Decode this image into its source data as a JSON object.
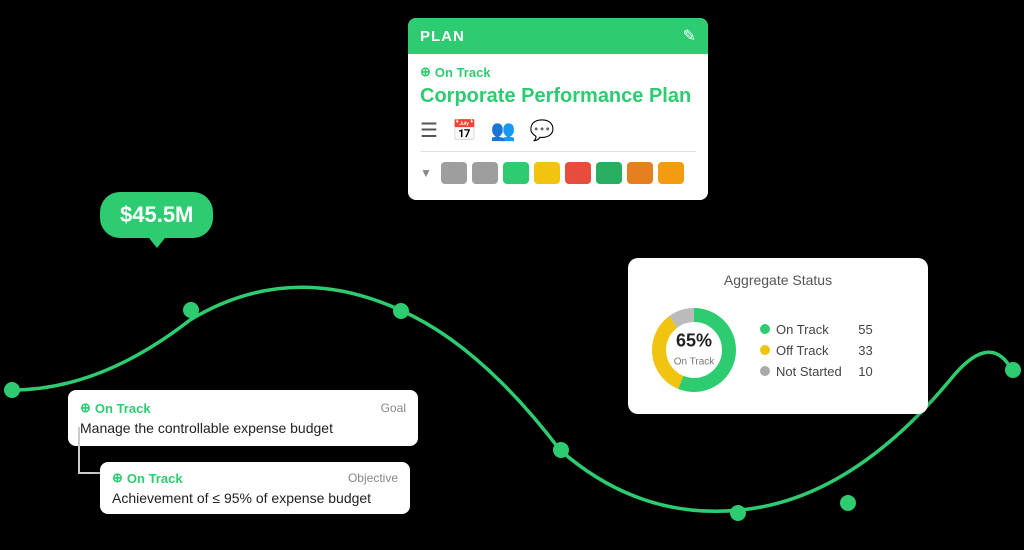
{
  "plan_card": {
    "header_label": "PLAN",
    "edit_icon": "✎",
    "on_track_icon": "⊕",
    "on_track_label": "On Track",
    "name": "Corporate Performance Plan",
    "toolbar_icons": [
      "☰",
      "📅",
      "👥",
      "💬"
    ],
    "colors": [
      "#9e9e9e",
      "#9e9e9e",
      "#2ecc71",
      "#f1c40f",
      "#e74c3c",
      "#27ae60",
      "#e67e22",
      "#f39c12"
    ]
  },
  "money_bubble": {
    "value": "$45.5M"
  },
  "goal_card": {
    "status_icon": "⊕",
    "status_label": "On Track",
    "type_label": "Goal",
    "description": "Manage the controllable expense budget"
  },
  "objective_card": {
    "status_icon": "⊕",
    "status_label": "On Track",
    "type_label": "Objective",
    "description": "Achievement of ≤ 95% of expense budget"
  },
  "aggregate_card": {
    "title": "Aggregate Status",
    "percent": "65%",
    "percent_label": "On Track",
    "legend": [
      {
        "label": "On Track",
        "color": "#2ecc71",
        "count": "55"
      },
      {
        "label": "Off Track",
        "color": "#f1c40f",
        "count": "33"
      },
      {
        "label": "Not Started",
        "color": "#aaa",
        "count": "10"
      }
    ]
  },
  "donut": {
    "on_track_pct": 65,
    "off_track_pct": 33,
    "not_started_pct": 10
  }
}
